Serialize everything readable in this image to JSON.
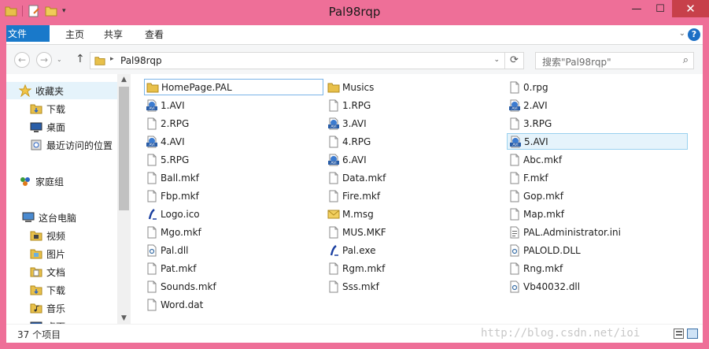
{
  "window": {
    "title": "Pal98rqp",
    "minimize": "—",
    "maximize": "☐",
    "close": "✕"
  },
  "ribbon": {
    "tabs": [
      "文件",
      "主页",
      "共享",
      "查看"
    ],
    "expand": "⌄",
    "help": "?"
  },
  "address": {
    "back": "←",
    "forward": "→",
    "history": "⌄",
    "up": "↑",
    "separator": "▸",
    "path": "Pal98rqp",
    "dropdown": "⌄",
    "refresh": "⟳"
  },
  "search": {
    "placeholder": "搜索\"Pal98rqp\"",
    "icon": "⌕"
  },
  "nav": {
    "items": [
      {
        "label": "收藏夹",
        "icon": "star-icon"
      },
      {
        "label": "下载",
        "icon": "download-folder-icon"
      },
      {
        "label": "桌面",
        "icon": "desktop-icon"
      },
      {
        "label": "最近访问的位置",
        "icon": "recent-places-icon"
      },
      {
        "label": "家庭组",
        "icon": "homegroup-icon"
      },
      {
        "label": "这台电脑",
        "icon": "computer-icon"
      },
      {
        "label": "视频",
        "icon": "videos-folder-icon"
      },
      {
        "label": "图片",
        "icon": "pictures-folder-icon"
      },
      {
        "label": "文档",
        "icon": "documents-folder-icon"
      },
      {
        "label": "下载",
        "icon": "download-folder-icon"
      },
      {
        "label": "音乐",
        "icon": "music-folder-icon"
      },
      {
        "label": "桌面",
        "icon": "desktop-icon"
      }
    ],
    "scroll_up": "▲",
    "scroll_down": "▼"
  },
  "files": [
    {
      "name": "HomePage.PAL",
      "icon": "folder"
    },
    {
      "name": "Musics",
      "icon": "folder"
    },
    {
      "name": "0.rpg",
      "icon": "doc"
    },
    {
      "name": "1.AVI",
      "icon": "avi"
    },
    {
      "name": "1.RPG",
      "icon": "doc"
    },
    {
      "name": "2.AVI",
      "icon": "avi"
    },
    {
      "name": "2.RPG",
      "icon": "doc"
    },
    {
      "name": "3.AVI",
      "icon": "avi"
    },
    {
      "name": "3.RPG",
      "icon": "doc"
    },
    {
      "name": "4.AVI",
      "icon": "avi"
    },
    {
      "name": "4.RPG",
      "icon": "doc"
    },
    {
      "name": "5.AVI",
      "icon": "avi"
    },
    {
      "name": "5.RPG",
      "icon": "doc"
    },
    {
      "name": "6.AVI",
      "icon": "avi"
    },
    {
      "name": "Abc.mkf",
      "icon": "doc"
    },
    {
      "name": "Ball.mkf",
      "icon": "doc"
    },
    {
      "name": "Data.mkf",
      "icon": "doc"
    },
    {
      "name": "F.mkf",
      "icon": "doc"
    },
    {
      "name": "Fbp.mkf",
      "icon": "doc"
    },
    {
      "name": "Fire.mkf",
      "icon": "doc"
    },
    {
      "name": "Gop.mkf",
      "icon": "doc"
    },
    {
      "name": "Logo.ico",
      "icon": "ico"
    },
    {
      "name": "M.msg",
      "icon": "mail"
    },
    {
      "name": "Map.mkf",
      "icon": "doc"
    },
    {
      "name": "Mgo.mkf",
      "icon": "doc"
    },
    {
      "name": "MUS.MKF",
      "icon": "doc"
    },
    {
      "name": "PAL.Administrator.ini",
      "icon": "ini"
    },
    {
      "name": "Pal.dll",
      "icon": "dll"
    },
    {
      "name": "Pal.exe",
      "icon": "ico"
    },
    {
      "name": "PALOLD.DLL",
      "icon": "dll"
    },
    {
      "name": "Pat.mkf",
      "icon": "doc"
    },
    {
      "name": "Rgm.mkf",
      "icon": "doc"
    },
    {
      "name": "Rng.mkf",
      "icon": "doc"
    },
    {
      "name": "Sounds.mkf",
      "icon": "doc"
    },
    {
      "name": "Sss.mkf",
      "icon": "doc"
    },
    {
      "name": "Vb40032.dll",
      "icon": "dll"
    },
    {
      "name": "Word.dat",
      "icon": "doc"
    }
  ],
  "status": {
    "count": "37 个项目",
    "watermark": "http://blog.csdn.net/ioi"
  }
}
